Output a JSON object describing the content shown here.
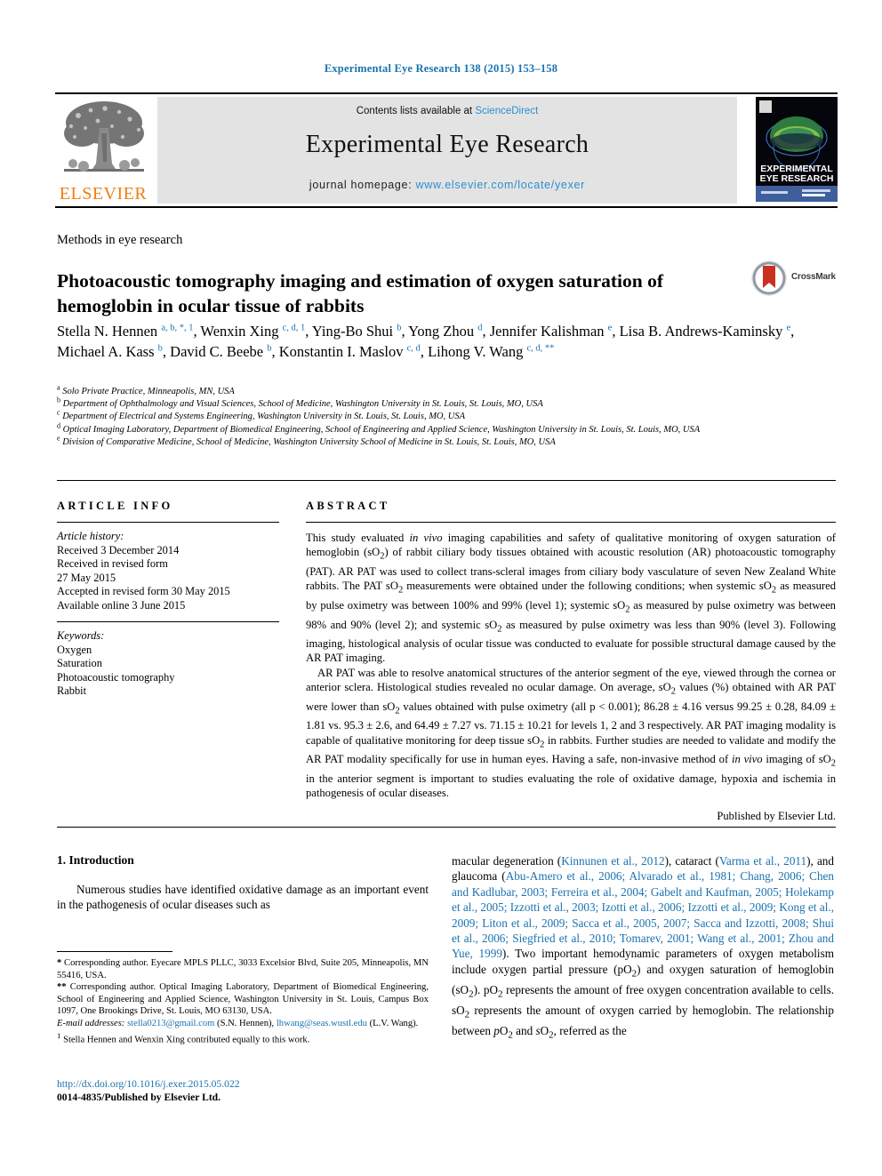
{
  "running_head": "Experimental Eye Research 138 (2015) 153–158",
  "masthead": {
    "contents_prefix": "Contents lists available at ",
    "contents_link": "ScienceDirect",
    "journal_name": "Experimental Eye Research",
    "homepage_prefix": "journal homepage: ",
    "homepage_url": "www.elsevier.com/locate/yexer",
    "publisher_wordmark": "ELSEVIER",
    "cover_title_line1": "EXPERIMENTAL",
    "cover_title_line2": "EYE RESEARCH"
  },
  "colors": {
    "link_blue": "#1a72b0",
    "masthead_link_blue": "#2b8fd0",
    "elsevier_orange": "#f07e13",
    "panel_grey": "#e3e3e3"
  },
  "article": {
    "type": "Methods in eye research",
    "title": "Photoacoustic tomography imaging and estimation of oxygen saturation of hemoglobin in ocular tissue of rabbits",
    "crossmark_label": "CrossMark",
    "authors_html": "Stella N. Hennen <sup>a, b, *, 1</sup>, Wenxin Xing <sup>c, d, 1</sup>, Ying-Bo Shui <sup>b</sup>, Yong Zhou <sup>d</sup>, Jennifer Kalishman <sup>e</sup>, Lisa B. Andrews-Kaminsky <sup>e</sup>, Michael A. Kass <sup>b</sup>, David C. Beebe <sup>b</sup>, Konstantin I. Maslov <sup>c, d</sup>, Lihong V. Wang <sup>c, d, **</sup>",
    "affiliations": [
      {
        "label": "a",
        "text": "Solo Private Practice, Minneapolis, MN, USA"
      },
      {
        "label": "b",
        "text": "Department of Ophthalmology and Visual Sciences, School of Medicine, Washington University in St. Louis, St. Louis, MO, USA"
      },
      {
        "label": "c",
        "text": "Department of Electrical and Systems Engineering, Washington University in St. Louis, St. Louis, MO, USA"
      },
      {
        "label": "d",
        "text": "Optical Imaging Laboratory, Department of Biomedical Engineering, School of Engineering and Applied Science, Washington University in St. Louis, St. Louis, MO, USA"
      },
      {
        "label": "e",
        "text": "Division of Comparative Medicine, School of Medicine, Washington University School of Medicine in St. Louis, St. Louis, MO, USA"
      }
    ]
  },
  "article_info": {
    "heading": "ARTICLE INFO",
    "history_label": "Article history:",
    "history_lines": [
      "Received 3 December 2014",
      "Received in revised form",
      "27 May 2015",
      "Accepted in revised form 30 May 2015",
      "Available online 3 June 2015"
    ],
    "keywords_label": "Keywords:",
    "keywords": [
      "Oxygen",
      "Saturation",
      "Photoacoustic tomography",
      "Rabbit"
    ]
  },
  "abstract": {
    "heading": "ABSTRACT",
    "paragraph_1_html": "This study evaluated <i>in vivo</i> imaging capabilities and safety of qualitative monitoring of oxygen saturation of hemoglobin (sO<sub>2</sub>) of rabbit ciliary body tissues obtained with acoustic resolution (AR) photoacoustic tomography (PAT). AR PAT was used to collect trans-scleral images from ciliary body vasculature of seven New Zealand White rabbits. The PAT sO<sub>2</sub> measurements were obtained under the following conditions; when systemic sO<sub>2</sub> as measured by pulse oximetry was between 100% and 99% (level 1); systemic sO<sub>2</sub> as measured by pulse oximetry was between 98% and 90% (level 2); and systemic sO<sub>2</sub> as measured by pulse oximetry was less than 90% (level 3). Following imaging, histological analysis of ocular tissue was conducted to evaluate for possible structural damage caused by the AR PAT imaging.",
    "paragraph_2_html": "AR PAT was able to resolve anatomical structures of the anterior segment of the eye, viewed through the cornea or anterior sclera. Histological studies revealed no ocular damage. On average, sO<sub>2</sub> values (%) obtained with AR PAT were lower than sO<sub>2</sub> values obtained with pulse oximetry (all p &lt; 0.001); 86.28 &plusmn; 4.16 versus 99.25 &plusmn; 0.28, 84.09 &plusmn; 1.81 vs. 95.3 &plusmn; 2.6, and 64.49 &plusmn; 7.27 vs. 71.15 &plusmn; 10.21 for levels 1, 2 and 3 respectively. AR PAT imaging modality is capable of qualitative monitoring for deep tissue sO<sub>2</sub> in rabbits. Further studies are needed to validate and modify the AR PAT modality specifically for use in human eyes. Having a safe, non-invasive method of <i>in vivo</i> imaging of sO<sub>2</sub> in the anterior segment is important to studies evaluating the role of oxidative damage, hypoxia and ischemia in pathogenesis of ocular diseases.",
    "publisher_line": "Published by Elsevier Ltd."
  },
  "introduction": {
    "heading": "1. Introduction",
    "left_paragraph_html": "Numerous studies have identified oxidative damage as an important event in the pathogenesis of ocular diseases such as",
    "right_paragraph_html": "macular degeneration (<span class=\"cite\">Kinnunen et al., 2012</span>), cataract (<span class=\"cite\">Varma et al., 2011</span>), and glaucoma (<span class=\"cite\">Abu-Amero et al., 2006; Alvarado et al., 1981; Chang, 2006; Chen and Kadlubar, 2003; Ferreira et al., 2004; Gabelt and Kaufman, 2005; Holekamp et al., 2005; Izzotti et al., 2003; Izotti et al., 2006; Izzotti et al., 2009; Kong et al., 2009; Liton et al., 2009; Sacca et al., 2005, 2007; Sacca and Izzotti, 2008; Shui et al., 2006; Siegfried et al., 2010; Tomarev, 2001; Wang et al., 2001; Zhou and Yue, 1999</span>). Two important hemodynamic parameters of oxygen metabolism include oxygen partial pressure (pO<sub>2</sub>) and oxygen saturation of hemoglobin (sO<sub>2</sub>). pO<sub>2</sub> represents the amount of free oxygen concentration available to cells. sO<sub>2</sub> represents the amount of oxygen carried by hemoglobin. The relationship between <i>p</i>O<sub>2</sub> and <i>s</i>O<sub>2</sub>, referred as the"
  },
  "footnotes": {
    "corresponding_1_html": "<b>*</b> Corresponding author. Eyecare MPLS PLLC, 3033 Excelsior Blvd, Suite 205, Minneapolis, MN 55416, USA.",
    "corresponding_2_html": "<b>**</b> Corresponding author. Optical Imaging Laboratory, Department of Biomedical Engineering, School of Engineering and Applied Science, Washington University in St. Louis, Campus Box 1097, One Brookings Drive, St. Louis, MO 63130, USA.",
    "email_html": "<i>E-mail addresses:</i> <span class=\"link\">stella0213@gmail.com</span> (S.N. Hennen), <span class=\"link\">lhwang@seas.wustl.edu</span> (L.V. Wang).",
    "equal_contribution_html": "<sup>1</sup> Stella Hennen and Wenxin Xing contributed equally to this work."
  },
  "footer": {
    "doi": "http://dx.doi.org/10.1016/j.exer.2015.05.022",
    "issn_line": "0014-4835/Published by Elsevier Ltd."
  }
}
